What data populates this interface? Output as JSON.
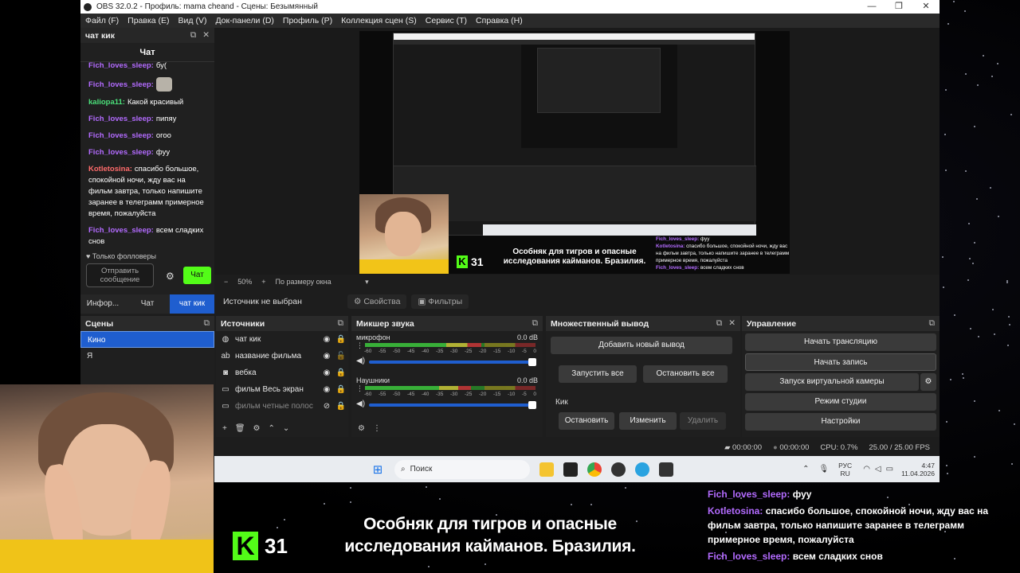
{
  "window": {
    "title": "OBS 32.0.2 - Профиль: mama cheand - Сцены: Безымянный",
    "controls": [
      "—",
      "❐",
      "✕"
    ]
  },
  "menu": [
    "Файл (F)",
    "Правка (E)",
    "Вид (V)",
    "Док-панели (D)",
    "Профиль (P)",
    "Коллекция сцен (S)",
    "Сервис (T)",
    "Справка (H)"
  ],
  "chat_dock": {
    "dock_title": "чат кик",
    "header": "Чат",
    "messages": [
      {
        "user": "Fich_loves_sleep:",
        "text": "бу(",
        "user_color": "#b36bff"
      },
      {
        "user": "Fich_loves_sleep:",
        "text": "",
        "emote": true,
        "user_color": "#b36bff"
      },
      {
        "user": "kaliopa11:",
        "text": "Какой красивый",
        "user_color": "#4be07a"
      },
      {
        "user": "Fich_loves_sleep:",
        "text": "пипяу",
        "user_color": "#b36bff"
      },
      {
        "user": "Fich_loves_sleep:",
        "text": "огоо",
        "user_color": "#b36bff"
      },
      {
        "user": "Fich_loves_sleep:",
        "text": "фуу",
        "user_color": "#b36bff"
      },
      {
        "user": "Kotletosina:",
        "text": "спасибо большое, спокойной ночи, жду вас на фильм завтра, только напишите заранее в телеграмм примерное время, пожалуйста",
        "user_color": "#ff6b6b"
      },
      {
        "user": "Fich_loves_sleep:",
        "text": "всем сладких снов",
        "user_color": "#b36bff"
      }
    ],
    "followers_only": "♥ Только фолловеры",
    "send_placeholder": "Отправить сообщение",
    "send_button": "Чат",
    "tabs": [
      "Инфор...",
      "Чат",
      "чат кик"
    ],
    "active_tab": 2
  },
  "preview": {
    "zoom_percent": "50%",
    "fit_label": "По размеру окна",
    "nested_counter": "31",
    "nested_caption": "Особняк для тигров и опасные исследования кайманов. Бразилия.",
    "nested_chat": [
      {
        "user": "Fich_loves_sleep:",
        "text": "фуу"
      },
      {
        "user": "Kotletosina:",
        "text": "спасибо большое, спокойной ночи, жду вас на фильм завтра, только напишите заранее в телеграмм примерное время, пожалуйста"
      },
      {
        "user": "Fich_loves_sleep:",
        "text": "всем сладких снов"
      }
    ]
  },
  "source_toolbar": {
    "no_source": "Источник не выбран",
    "properties": "Свойства",
    "filters": "Фильтры"
  },
  "scenes": {
    "title": "Сцены",
    "items": [
      "Кино",
      "Я"
    ],
    "selected": 0
  },
  "sources": {
    "title": "Источники",
    "items": [
      {
        "name": "чат кик",
        "icon": "globe-icon",
        "glyph": "◍",
        "visible": true,
        "locked": true
      },
      {
        "name": "название фильма",
        "icon": "text-icon",
        "glyph": "ab",
        "visible": true,
        "locked": false
      },
      {
        "name": "вебка",
        "icon": "camera-icon",
        "glyph": "◙",
        "visible": true,
        "locked": true
      },
      {
        "name": "фильм Весь экран",
        "icon": "window-icon",
        "glyph": "▭",
        "visible": true,
        "locked": true
      },
      {
        "name": "фильм четные полос",
        "icon": "window-icon",
        "glyph": "▭",
        "visible": false,
        "locked": true
      }
    ]
  },
  "mixer": {
    "title": "Микшер звука",
    "ticks": [
      "-60",
      "-55",
      "-50",
      "-45",
      "-40",
      "-35",
      "-30",
      "-25",
      "-20",
      "-15",
      "-10",
      "-5",
      "0"
    ],
    "channels": [
      {
        "name": "микрофон",
        "db": "0.0 dB",
        "level": 0.68,
        "volume": 1.0
      },
      {
        "name": "Наушники",
        "db": "0.0 dB",
        "level": 0.62,
        "volume": 1.0
      }
    ]
  },
  "multi_output": {
    "title": "Множественный вывод",
    "add_new": "Добавить новый вывод",
    "start_all": "Запустить все",
    "stop_all": "Остановить все",
    "target_name": "Кик",
    "stop": "Остановить",
    "edit": "Изменить",
    "delete": "Удалить"
  },
  "controls": {
    "title": "Управление",
    "buttons": [
      "Начать трансляцию",
      "Начать запись",
      "Запуск виртуальной камеры",
      "Режим студии",
      "Настройки"
    ]
  },
  "status": {
    "stream_time": "00:00:00",
    "rec_time": "00:00:00",
    "cpu": "CPU: 0.7%",
    "fps": "25.00 / 25.00 FPS"
  },
  "taskbar": {
    "search_placeholder": "Поиск",
    "lang_top": "РУС",
    "lang_bottom": "RU",
    "time": "4:47",
    "date": "11.04.2026"
  },
  "overlay": {
    "counter": "31",
    "caption": "Особняк для тигров и опасные исследования кайманов. Бразилия.",
    "chat": [
      {
        "user": "Fich_loves_sleep:",
        "text": "фуу"
      },
      {
        "user": "Kotletosina:",
        "text": "спасибо большое, спокойной ночи, жду вас на фильм завтра, только напишите заранее в телеграмм примерное время, пожалуйста"
      },
      {
        "user": "Fich_loves_sleep:",
        "text": "всем сладких снов"
      }
    ]
  }
}
